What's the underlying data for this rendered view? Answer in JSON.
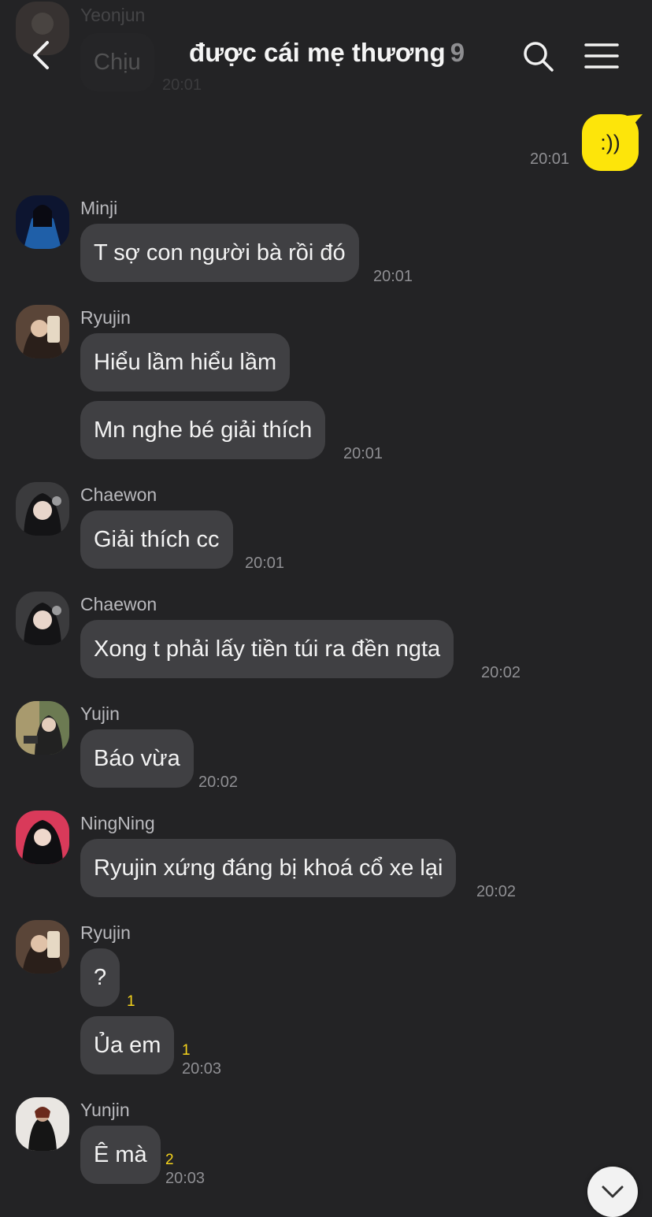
{
  "header": {
    "title": "được cái mẹ thương",
    "member_count": "9"
  },
  "faded_top": {
    "name": "Yeonjun",
    "message": "Chịu",
    "time": "20:01"
  },
  "my_message": {
    "text": ":))",
    "time": "20:01"
  },
  "messages": [
    {
      "name": "Minji",
      "bubbles": [
        "T sợ con người bà rồi đó"
      ],
      "time": "20:01"
    },
    {
      "name": "Ryujin",
      "bubbles": [
        "Hiểu lầm hiểu lầm",
        "Mn nghe bé giải thích"
      ],
      "time": "20:01"
    },
    {
      "name": "Chaewon",
      "bubbles": [
        "Giải thích cc"
      ],
      "time": "20:01"
    },
    {
      "name": "Chaewon",
      "bubbles": [
        "Xong t phải lấy tiền túi ra đền ngta"
      ],
      "time": "20:02"
    },
    {
      "name": "Yujin",
      "bubbles": [
        "Báo vừa"
      ],
      "time": "20:02"
    },
    {
      "name": "NingNing",
      "bubbles": [
        "Ryujin xứng đáng bị khoá cổ xe lại"
      ],
      "time": "20:02"
    },
    {
      "name": "Ryujin",
      "bubbles": [
        "?",
        "Ủa em"
      ],
      "unread": [
        "1",
        "1"
      ],
      "time": "20:03"
    },
    {
      "name": "Yunjin",
      "bubbles": [
        "Ê mà"
      ],
      "unread": [
        "2"
      ],
      "time": "20:03"
    }
  ],
  "icons": {
    "back": "chevron-left-icon",
    "search": "search-icon",
    "menu": "hamburger-menu-icon",
    "scroll": "chevron-down-icon"
  },
  "colors": {
    "background": "#232325",
    "bubble": "#404043",
    "my_bubble": "#fde50a",
    "unread": "#f5d31c"
  }
}
